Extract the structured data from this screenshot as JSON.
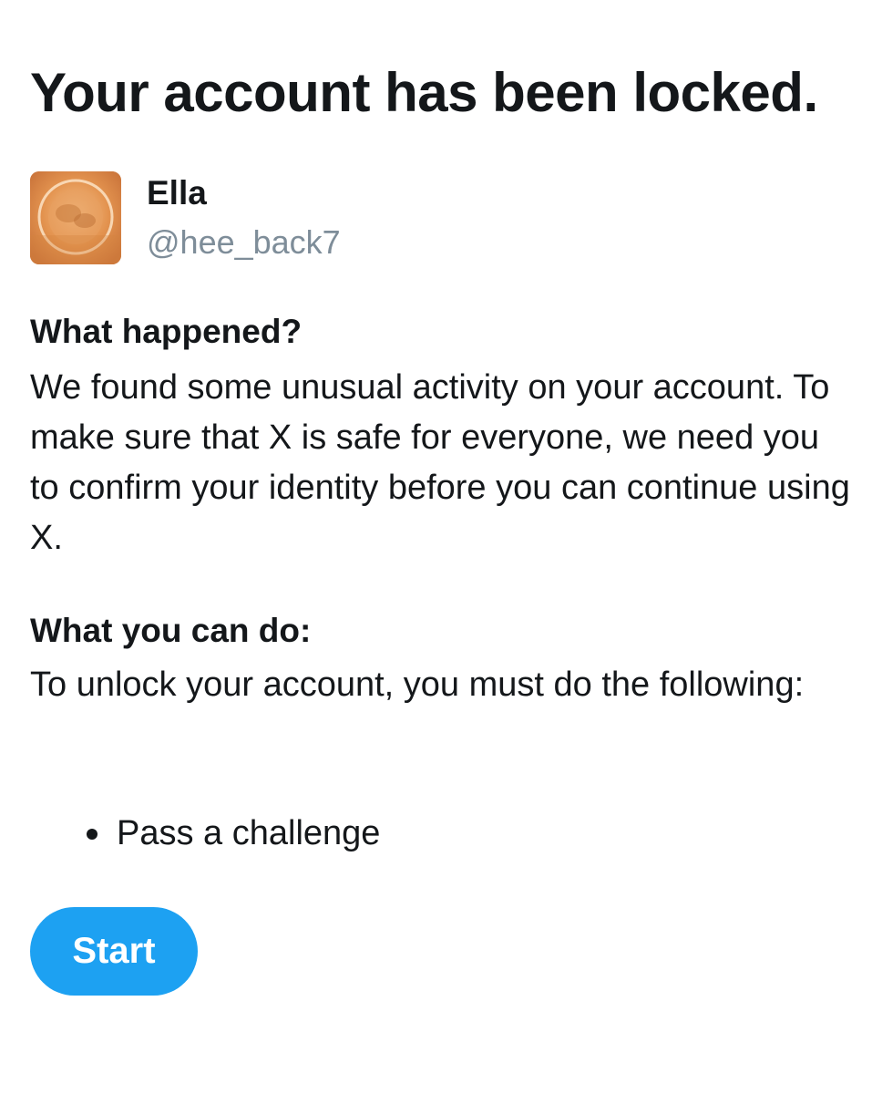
{
  "header": {
    "title": "Your account has been locked."
  },
  "profile": {
    "display_name": "Ella",
    "handle": "@hee_back7",
    "avatar_icon": "profile-avatar",
    "avatar_color": "#e39350"
  },
  "sections": {
    "what_happened": {
      "heading": "What happened?",
      "body": "We found some unusual activity on your account. To make sure that X is safe for everyone, we need you to confirm your identity before you can continue using X."
    },
    "what_you_can_do": {
      "heading": "What you can do:",
      "body": "To unlock your account, you must do the following:",
      "requirements": [
        "Pass a challenge"
      ]
    }
  },
  "actions": {
    "start_label": "Start",
    "start_color": "#1da1f2"
  },
  "colors": {
    "text_primary": "#14171a",
    "text_secondary": "#7e8d99",
    "background": "#ffffff"
  }
}
